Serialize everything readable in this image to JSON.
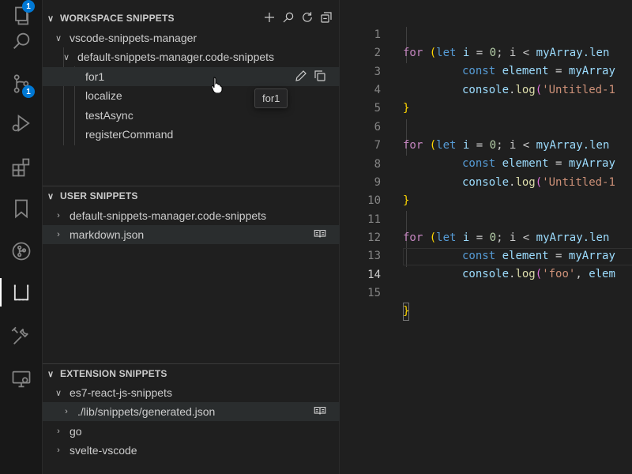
{
  "activity_bar": {
    "explorer_badge": "1",
    "scm_badge": "1"
  },
  "sections": {
    "workspace": {
      "title": "WORKSPACE SNIPPETS",
      "folder": "vscode-snippets-manager",
      "file": "default-snippets-manager.code-snippets",
      "items": [
        "for1",
        "localize",
        "testAsync",
        "registerCommand"
      ]
    },
    "user": {
      "title": "USER SNIPPETS",
      "items": [
        "default-snippets-manager.code-snippets",
        "markdown.json"
      ]
    },
    "extension": {
      "title": "EXTENSION SNIPPETS",
      "folder": "es7-react-js-snippets",
      "file": "./lib/snippets/generated.json",
      "items": [
        "go",
        "svelte-vscode"
      ]
    }
  },
  "tooltip": "for1",
  "editor": {
    "line_numbers": [
      "1",
      "2",
      "3",
      "4",
      "5",
      "6",
      "7",
      "8",
      "9",
      "10",
      "11",
      "12",
      "13",
      "14",
      "15"
    ],
    "tokens": {
      "for": "for",
      "let": "let",
      "i": "i",
      "eq": " = ",
      "zero": "0",
      "lt": "; i < ",
      "myArray": "myArray",
      "dot_len": ".len",
      "const": "const",
      "element": "element",
      "myArray_trunc": "myArray",
      "console": "console",
      "log": "log",
      "str1": "'Untitled-1",
      "str_foo": "'foo'",
      "elem_trunc": "elem",
      "open_brace": "}",
      "close_brace": "}"
    }
  },
  "colors": {
    "accent": "#0078d4",
    "keyword": "#c586c0",
    "storage": "#569cd6",
    "variable": "#9cdcfe",
    "function": "#dcdcaa",
    "string": "#ce9178",
    "bracket": "#ffd700"
  }
}
